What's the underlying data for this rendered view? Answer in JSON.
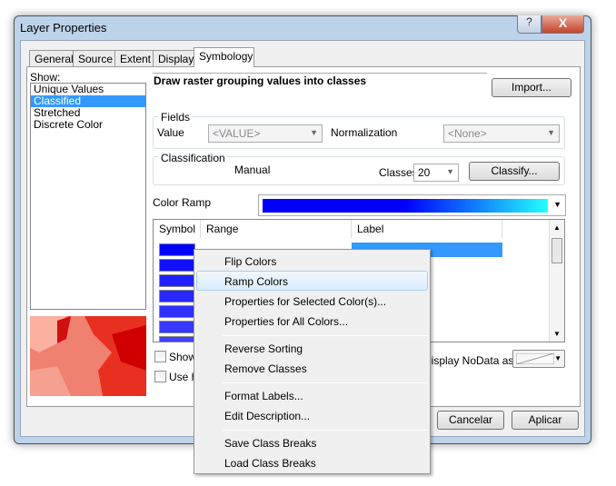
{
  "window": {
    "title": "Layer Properties",
    "help": "?",
    "close": "X"
  },
  "tabs": [
    {
      "label": "General"
    },
    {
      "label": "Source"
    },
    {
      "label": "Extent"
    },
    {
      "label": "Display"
    },
    {
      "label": "Symbology"
    }
  ],
  "show": {
    "label": "Show:",
    "items": [
      "Unique Values",
      "Classified",
      "Stretched",
      "Discrete Color"
    ],
    "selected": "Classified"
  },
  "heading": "Draw raster grouping values into classes",
  "import_label": "Import...",
  "fields": {
    "legend": "Fields",
    "value_label": "Value",
    "value": "<VALUE>",
    "normalization_label": "Normalization",
    "normalization": "<None>"
  },
  "classification": {
    "legend": "Classification",
    "method": "Manual",
    "classes_label": "Classes",
    "classes": "20",
    "classify_label": "Classify..."
  },
  "color_ramp": {
    "label": "Color Ramp",
    "colors": [
      "#0000ff",
      "#0000ff",
      "#22ffff"
    ]
  },
  "grid": {
    "headers": [
      "Symbol",
      "Range",
      "Label"
    ],
    "swatches": [
      "#0000ff",
      "#1010ff",
      "#2020ff",
      "#2828ff",
      "#3030ff",
      "#3838ff",
      "#4040ff"
    ]
  },
  "checks": {
    "show": "Show",
    "use": "Use h",
    "nodata_label": "Display NoData as"
  },
  "menu": {
    "items": [
      "Flip Colors",
      "Ramp Colors",
      "Properties for Selected Color(s)...",
      "Properties for All Colors...",
      "Reverse Sorting",
      "Remove Classes",
      "Format Labels...",
      "Edit Description...",
      "Save Class Breaks",
      "Load Class Breaks"
    ],
    "highlighted": "Ramp Colors"
  },
  "buttons": {
    "cancel": "Cancelar",
    "apply": "Aplicar"
  }
}
